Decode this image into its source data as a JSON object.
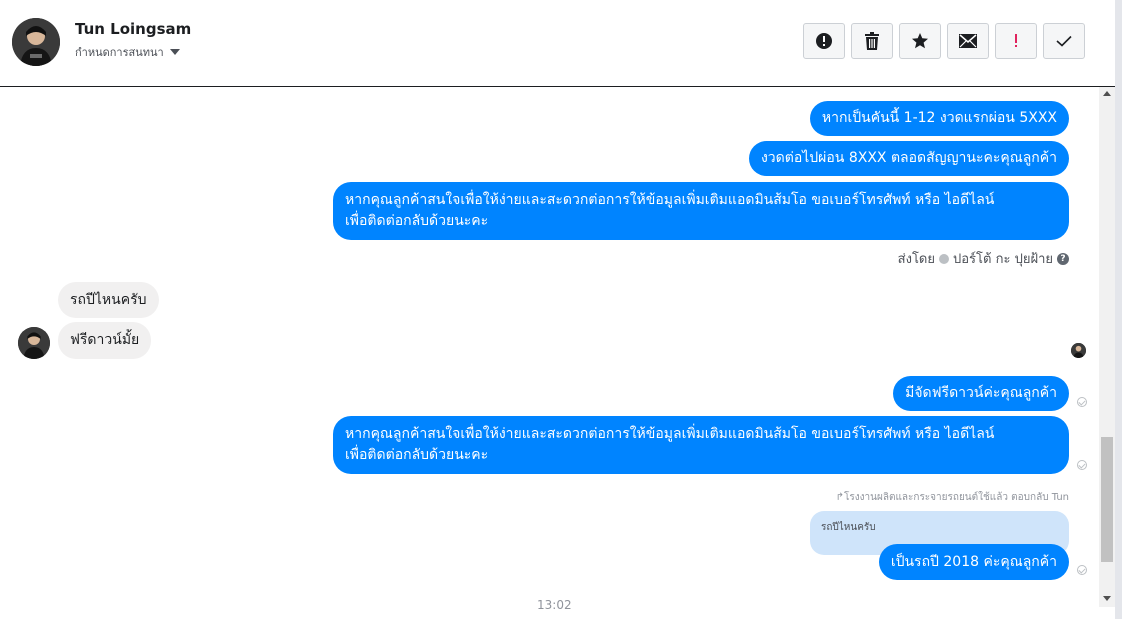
{
  "header": {
    "name": "Tun Loingsam",
    "subtitle": "กำหนดการสนทนา"
  },
  "toolbar": {
    "icons": [
      "alert-circle-icon",
      "trash-icon",
      "star-icon",
      "envelope-icon",
      "exclamation-icon",
      "check-icon"
    ]
  },
  "messages": {
    "out1": "หากเป็นคันนี้ 1-12 งวดแรกผ่อน 5XXX",
    "out2": "งวดต่อไปผ่อน 8XXX ตลอดสัญญานะคะคุณลูกค้า",
    "out3_line1": "หากคุณลูกค้าสนใจเพื่อให้ง่ายและสะดวกต่อการให้ข้อมูลเพิ่มเติมแอดมินส้มโอ ขอเบอร์โทรศัพท์ หรือ ไอดีไลน์",
    "out3_line2": "เพื่อติดต่อกลับด้วยนะคะ",
    "sent_by_label": "ส่งโดย",
    "sent_by_name": "ปอร์โต้ กะ ปุยฝ้าย",
    "in1": "รถปีไหนครับ",
    "in2": "ฟรีดาวน์มั้ย",
    "out4": "มีจัดฟรีดาวน์ค่ะคุณลูกค้า",
    "out5_line1": "หากคุณลูกค้าสนใจเพื่อให้ง่ายและสะดวกต่อการให้ข้อมูลเพิ่มเติมแอดมินส้มโอ ขอเบอร์โทรศัพท์ หรือ ไอดีไลน์",
    "out5_line2": "เพื่อติดต่อกลับด้วยนะคะ",
    "reply_note": "โรงงานผลิตและกระจายรถยนต์ใช้แล้ว ตอบกลับ Tun",
    "quoted": "รถปีไหนครับ",
    "out6": "เป็นรถปี 2018 ค่ะคุณลูกค้า",
    "time": "13:02"
  },
  "colors": {
    "outgoing": "#0084ff",
    "incoming": "#f1f0f0",
    "quoted": "#cfe4fa"
  }
}
